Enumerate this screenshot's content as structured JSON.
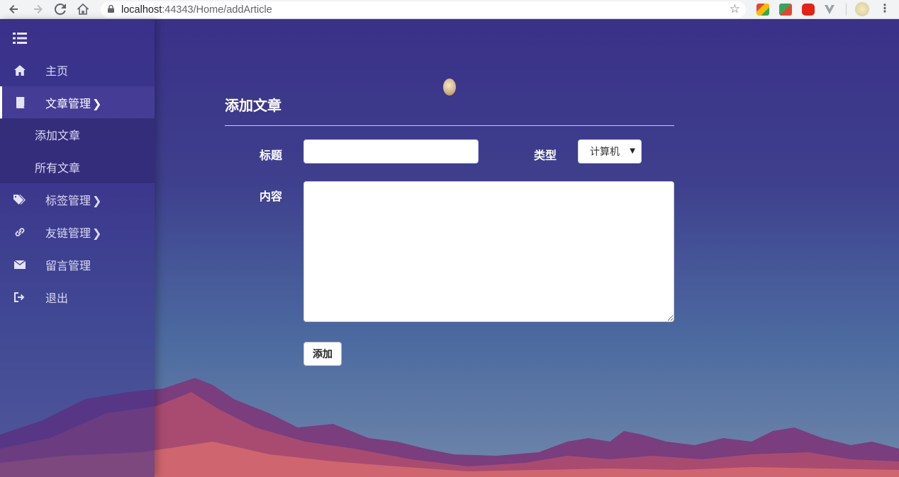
{
  "browser": {
    "url_host": "localhost",
    "url_path": ":44343/Home/addArticle",
    "icons": [
      "back-icon",
      "forward-icon",
      "reload-icon",
      "home-icon",
      "lock-icon",
      "star-icon",
      "menu-kebab-icon"
    ]
  },
  "sidebar": {
    "items": [
      {
        "label": "主页",
        "icon": "home-icon"
      },
      {
        "label": "文章管理",
        "icon": "book-icon",
        "has_chevron": true,
        "active": true
      },
      {
        "label": "标签管理",
        "icon": "tags-icon",
        "has_chevron": true
      },
      {
        "label": "友链管理",
        "icon": "link-icon",
        "has_chevron": true
      },
      {
        "label": "留言管理",
        "icon": "envelope-icon"
      },
      {
        "label": "退出",
        "icon": "logout-icon"
      }
    ],
    "submenu": [
      {
        "label": "添加文章"
      },
      {
        "label": "所有文章"
      }
    ],
    "chevron": "❯"
  },
  "form": {
    "title": "添加文章",
    "title_label": "标题",
    "title_value": "",
    "type_label": "类型",
    "type_selected": "计算机",
    "content_label": "内容",
    "content_value": "",
    "submit_label": "添加"
  },
  "colors": {
    "accent": "#ffffff",
    "background_top": "#3a3188",
    "background_bottom": "#6f87aa"
  }
}
